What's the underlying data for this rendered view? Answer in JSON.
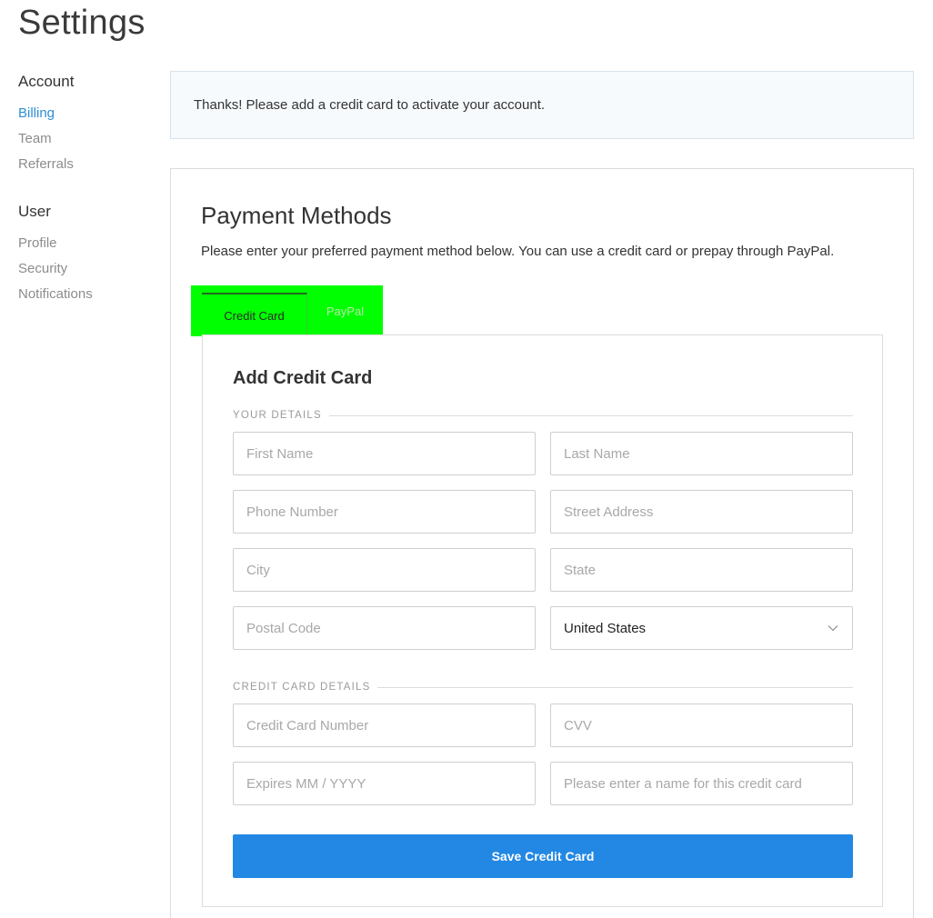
{
  "page": {
    "title": "Settings"
  },
  "sidebar": {
    "account": {
      "heading": "Account",
      "items": [
        {
          "label": "Billing",
          "active": true
        },
        {
          "label": "Team"
        },
        {
          "label": "Referrals"
        }
      ]
    },
    "user": {
      "heading": "User",
      "items": [
        {
          "label": "Profile"
        },
        {
          "label": "Security"
        },
        {
          "label": "Notifications"
        }
      ]
    }
  },
  "notice": {
    "text": "Thanks! Please add a credit card to activate your account."
  },
  "payment": {
    "title": "Payment Methods",
    "description": "Please enter your preferred payment method below. You can use a credit card or prepay through PayPal.",
    "tabs": [
      {
        "label": "Credit Card",
        "active": true
      },
      {
        "label": "PayPal"
      }
    ],
    "highlight_color": "#00ff00"
  },
  "form": {
    "title": "Add Credit Card",
    "your_details_label": "YOUR DETAILS",
    "credit_details_label": "CREDIT CARD DETAILS",
    "fields": {
      "first_name": "First Name",
      "last_name": "Last Name",
      "phone": "Phone Number",
      "street": "Street Address",
      "city": "City",
      "state": "State",
      "postal": "Postal Code",
      "card_number": "Credit Card Number",
      "cvv": "CVV",
      "expires": "Expires MM / YYYY",
      "card_name": "Please enter a name for this credit card"
    },
    "country": {
      "selected": "United States",
      "icon": "chevron-down-icon"
    },
    "save_label": "Save Credit Card",
    "accent_color": "#2288e3"
  }
}
